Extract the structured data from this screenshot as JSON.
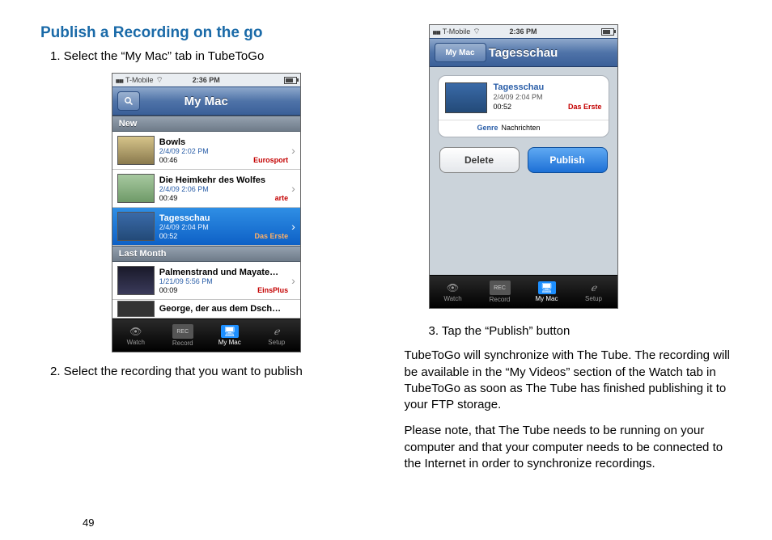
{
  "doc": {
    "heading": "Publish a Recording on the go",
    "step1": "1. Select the “My Mac” tab in TubeToGo",
    "step2": "2. Select the recording that you want to publish",
    "step3": "3. Tap the “Publish” button",
    "para1": "TubeToGo will synchronize with The Tube. The recording will be available in the “My Videos” section of the Watch tab in TubeToGo as soon as The Tube has finished publishing it to your FTP storage.",
    "para2": "Please note, that The Tube needs to be running on your computer and that your computer needs to be connected to the Internet in order to synchronize recordings.",
    "page_number": "49"
  },
  "status": {
    "carrier": "T-Mobile",
    "time": "2:36 PM"
  },
  "screen1": {
    "nav_title": "My Mac",
    "section_new": "New",
    "section_last": "Last Month",
    "rows": [
      {
        "title": "Bowls",
        "date": "2/4/09 2:02 PM",
        "duration": "00:46",
        "channel": "Eurosport"
      },
      {
        "title": "Die Heimkehr des Wolfes",
        "date": "2/4/09 2:06 PM",
        "duration": "00:49",
        "channel": "arte"
      },
      {
        "title": "Tagesschau",
        "date": "2/4/09 2:04 PM",
        "duration": "00:52",
        "channel": "Das Erste"
      },
      {
        "title": "Palmenstrand und Mayate…",
        "date": "1/21/09 5:56 PM",
        "duration": "00:09",
        "channel": "EinsPlus"
      },
      {
        "title": "George, der aus dem Dsch…",
        "date": "",
        "duration": "",
        "channel": ""
      }
    ]
  },
  "screen2": {
    "back_label": "My Mac",
    "nav_title": "Tagesschau",
    "card": {
      "title": "Tagesschau",
      "date": "2/4/09 2:04 PM",
      "duration": "00:52",
      "channel": "Das Erste"
    },
    "genre_label": "Genre",
    "genre_value": "Nachrichten",
    "delete": "Delete",
    "publish": "Publish"
  },
  "tabs": {
    "watch": "Watch",
    "record": "Record",
    "mymac": "My Mac",
    "setup": "Setup",
    "rec_badge": "REC"
  }
}
